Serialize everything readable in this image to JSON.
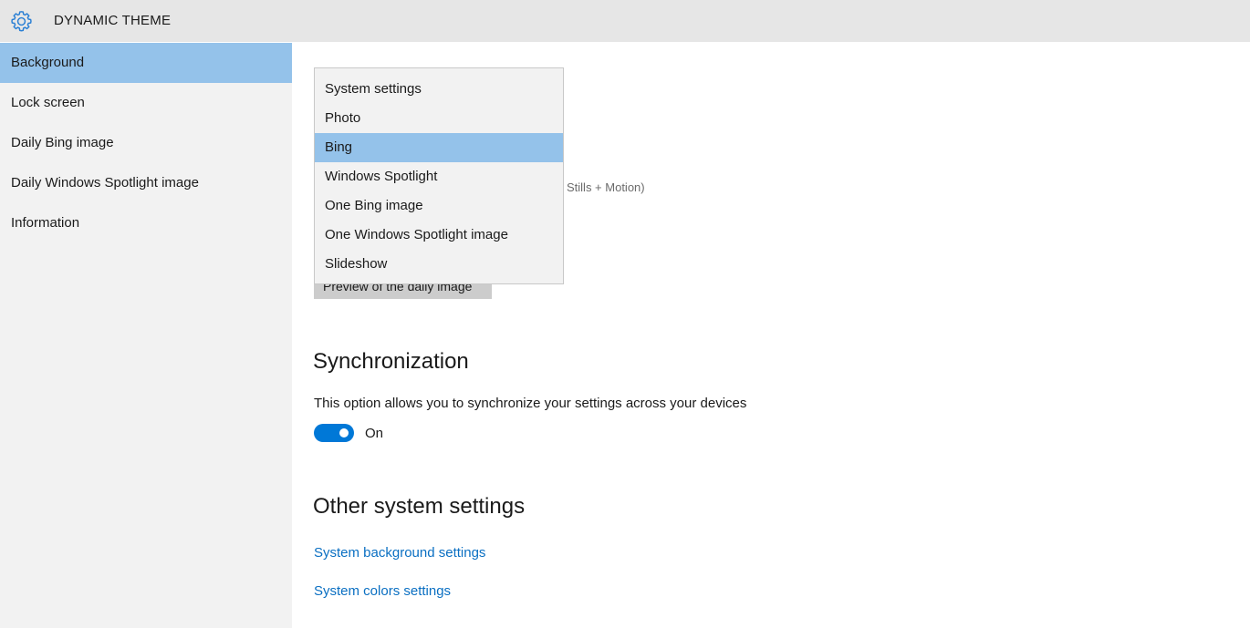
{
  "app": {
    "title": "DYNAMIC THEME",
    "icon": "gear-icon",
    "accent_color": "#0078d7",
    "selection_color": "#94c2ea"
  },
  "sidebar": {
    "items": [
      {
        "label": "Background",
        "selected": true
      },
      {
        "label": "Lock screen",
        "selected": false
      },
      {
        "label": "Daily Bing image",
        "selected": false
      },
      {
        "label": "Daily Windows Spotlight image",
        "selected": false
      },
      {
        "label": "Information",
        "selected": false
      }
    ]
  },
  "background": {
    "dropdown": {
      "options": [
        "System settings",
        "Photo",
        "Bing",
        "Windows Spotlight",
        "One Bing image",
        "One Windows Spotlight image",
        "Slideshow"
      ],
      "selected": "Bing"
    },
    "partial_text": "Stills + Motion)",
    "preview_button_label": "Preview of the daily image"
  },
  "synchronization": {
    "title": "Synchronization",
    "description": "This option allows you to synchronize your settings across your devices",
    "toggle_state": "On",
    "toggle_on": true
  },
  "other_settings": {
    "title": "Other system settings",
    "links": [
      "System background settings",
      "System colors settings"
    ]
  }
}
